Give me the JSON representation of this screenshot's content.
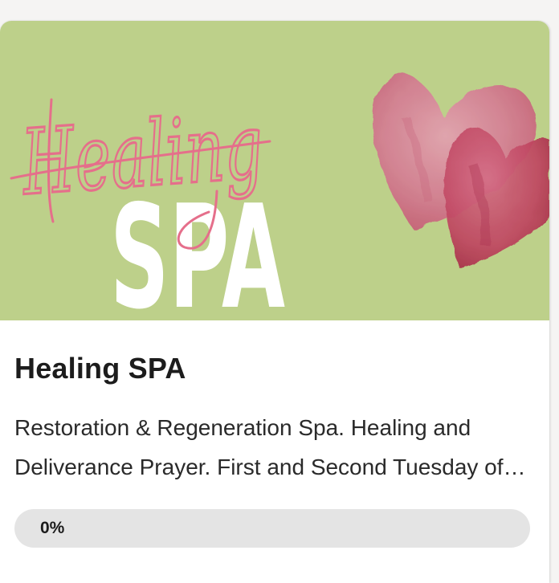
{
  "course": {
    "banner_script_text": "Healing",
    "banner_block_text": "SPA",
    "title": "Healing SPA",
    "description": "Restoration & Regeneration Spa. Healing and Deliverance Prayer. First and Second Tuesday of each month.",
    "progress_label": "0%",
    "progress_fraction": 0
  },
  "colors": {
    "banner_background": "#bdd08a",
    "script_pink": "#e56f8b",
    "block_white": "#ffffff",
    "heart_light": "#d97e97",
    "heart_dark": "#b8384f",
    "progress_track": "#e4e4e4",
    "progress_fill": "#5b8de0"
  }
}
